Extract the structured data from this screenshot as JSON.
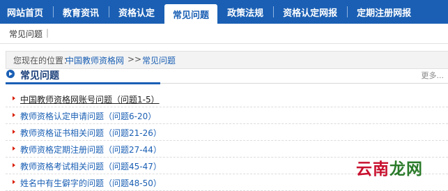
{
  "nav": {
    "items": [
      {
        "label": "网站首页",
        "active": false
      },
      {
        "label": "教育资讯",
        "active": false
      },
      {
        "label": "资格认定",
        "active": false
      },
      {
        "label": "常见问题",
        "active": true
      },
      {
        "label": "政策法规",
        "active": false
      },
      {
        "label": "资格认定网报",
        "active": false
      },
      {
        "label": "定期注册网报",
        "active": false
      }
    ]
  },
  "subnav": {
    "label": "常见问题",
    "separator": "|"
  },
  "breadcrumb": {
    "prefix": "您现在的位置：",
    "link": "中国教师资格网",
    "separator": ">>",
    "current": "常见问题"
  },
  "section": {
    "title": "常见问题",
    "more": "更多..."
  },
  "list": [
    "中国教师资格网账号问题（问题1-5）",
    "教师资格认定申请问题（问题6-20）",
    "教师资格证书相关问题（问题21-26）",
    "教师资格定期注册问题（问题27-44）",
    "教师资格考试相关问题（问题45-47）",
    "姓名中有生僻字的问题（问题48-50）"
  ],
  "watermark": {
    "part1": "云南",
    "part2": "龙网"
  },
  "colors": {
    "brand": "#1a5fb4",
    "bullet": "#d81e06",
    "watermark_red": "#c8102e",
    "watermark_green": "#2a7a2a"
  }
}
